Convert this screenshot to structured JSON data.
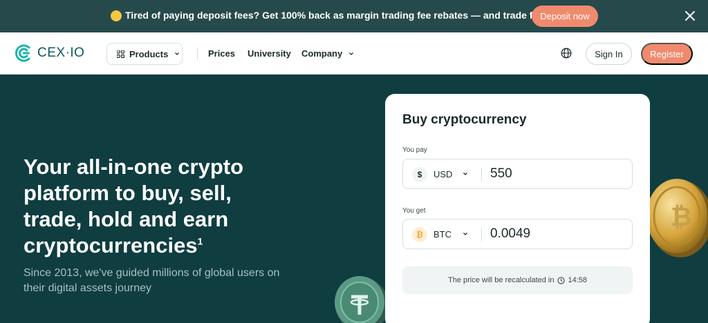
{
  "promo": {
    "icon": "thinking-face-emoji",
    "text": "Tired of paying deposit fees? Get 100% back as margin trading fee rebates — and trade for free!",
    "cta": "Deposit now"
  },
  "nav": {
    "logo": "CEX·IO",
    "products": "Products",
    "links": [
      "Prices",
      "University",
      "Company"
    ],
    "signin": "Sign In",
    "register": "Register"
  },
  "hero": {
    "title": "Your all-in-one crypto platform to buy, sell, trade, hold and earn cryptocurrencies",
    "title_sup": "1",
    "subtitle": "Since 2013, we've guided millions of global users on their digital assets journey"
  },
  "buy": {
    "title": "Buy cryptocurrency",
    "pay_label": "You pay",
    "pay_currency": "USD",
    "pay_symbol": "$",
    "pay_value": "550",
    "get_label": "You get",
    "get_currency": "BTC",
    "get_symbol": "₿",
    "get_value": "0.0049",
    "recalc_text": "The price will be recalculated in",
    "recalc_time": "14:58"
  },
  "colors": {
    "accent": "#f08a6f",
    "hero_bg": "#0f3d40",
    "banner_bg": "#264a4c",
    "btc_badge": "#f7a833"
  }
}
